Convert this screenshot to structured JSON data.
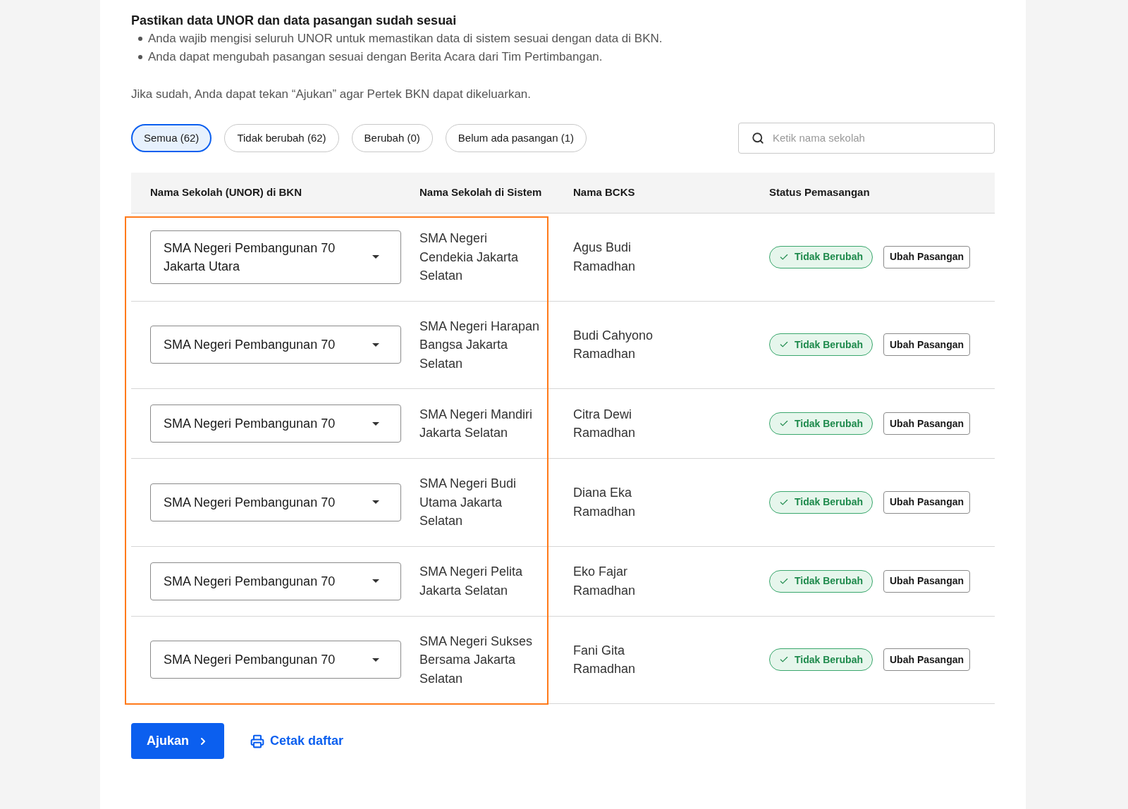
{
  "heading": "Pastikan data UNOR dan data pasangan sudah sesuai",
  "bullets": [
    "Anda wajib mengisi seluruh UNOR untuk memastikan data di sistem sesuai dengan data di BKN.",
    "Anda dapat mengubah pasangan sesuai dengan Berita Acara dari Tim Pertimbangan."
  ],
  "note": "Jika sudah, Anda dapat tekan “Ajukan” agar Pertek BKN dapat dikeluarkan.",
  "filters": [
    {
      "label": "Semua (62)",
      "selected": true
    },
    {
      "label": "Tidak berubah (62)",
      "selected": false
    },
    {
      "label": "Berubah (0)",
      "selected": false
    },
    {
      "label": "Belum ada pasangan (1)",
      "selected": false
    }
  ],
  "search": {
    "placeholder": "Ketik nama sekolah"
  },
  "table": {
    "columns": [
      "Nama Sekolah (UNOR) di BKN",
      "Nama Sekolah di Sistem",
      "Nama BCKS",
      "Status Pemasangan"
    ],
    "highlighted_columns": true,
    "rows": [
      {
        "unor": "SMA Negeri Pembangunan 70 Jakarta Utara",
        "sistem": "SMA Negeri Cendekia Jakarta Selatan",
        "bcks": "Agus Budi Ramadhan",
        "status": "Tidak Berubah",
        "action": "Ubah Pasangan"
      },
      {
        "unor": "SMA Negeri Pembangunan 70",
        "sistem": "SMA Negeri Harapan Bangsa Jakarta Selatan",
        "bcks": "Budi Cahyono Ramadhan",
        "status": "Tidak Berubah",
        "action": "Ubah Pasangan"
      },
      {
        "unor": "SMA Negeri Pembangunan 70",
        "sistem": "SMA Negeri Mandiri Jakarta Selatan",
        "bcks": "Citra Dewi Ramadhan",
        "status": "Tidak Berubah",
        "action": "Ubah Pasangan"
      },
      {
        "unor": "SMA Negeri Pembangunan 70",
        "sistem": "SMA Negeri Budi Utama Jakarta Selatan",
        "bcks": "Diana Eka Ramadhan",
        "status": "Tidak Berubah",
        "action": "Ubah Pasangan"
      },
      {
        "unor": "SMA Negeri Pembangunan 70",
        "sistem": "SMA Negeri Pelita Jakarta Selatan",
        "bcks": "Eko Fajar Ramadhan",
        "status": "Tidak Berubah",
        "action": "Ubah Pasangan"
      },
      {
        "unor": "SMA Negeri Pembangunan 70",
        "sistem": "SMA Negeri Sukses Bersama Jakarta Selatan",
        "bcks": "Fani Gita Ramadhan",
        "status": "Tidak Berubah",
        "action": "Ubah Pasangan"
      }
    ]
  },
  "submit": "Ajukan",
  "print": "Cetak daftar"
}
